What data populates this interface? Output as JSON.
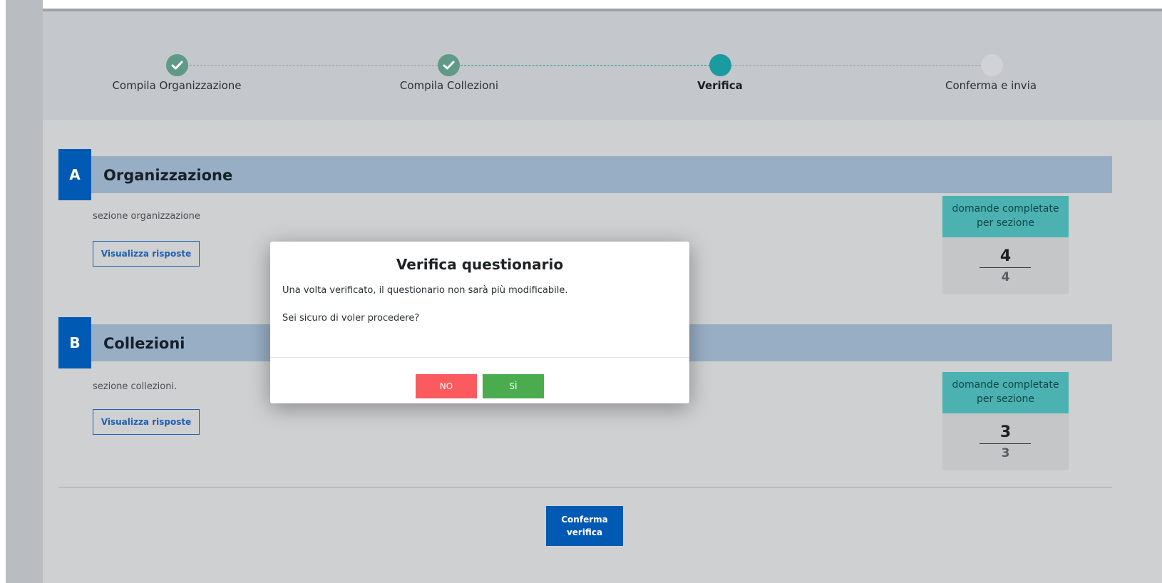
{
  "stepper": {
    "steps": [
      {
        "label": "Compila Organizzazione",
        "state": "done",
        "icon": "check-icon"
      },
      {
        "label": "Compila Collezioni",
        "state": "done",
        "icon": "check-icon"
      },
      {
        "label": "Verifica",
        "state": "current"
      },
      {
        "label": "Conferma e invia",
        "state": "todo"
      }
    ]
  },
  "sections": [
    {
      "letter": "A",
      "title": "Organizzazione",
      "description": "sezione organizzazione",
      "view_button": "Visualizza risposte",
      "stat": {
        "header": "domande completate per sezione",
        "completed": "4",
        "total": "4"
      }
    },
    {
      "letter": "B",
      "title": "Collezioni",
      "description": "sezione collezioni.",
      "view_button": "Visualizza risposte",
      "stat": {
        "header": "domande completate per sezione",
        "completed": "3",
        "total": "3"
      }
    }
  ],
  "footer": {
    "confirm_button": "Conferma verifica"
  },
  "dialog": {
    "title": "Verifica questionario",
    "message": "Una volta verificato, il questionario non sarà più modificabile.",
    "question": "Sei sicuro di voler procedere?",
    "no_label": "NO",
    "yes_label": "SÌ"
  },
  "colors": {
    "accent_blue": "#0059b3",
    "section_bar": "#98aec4",
    "stat_header": "#4bb1b1",
    "step_done": "#5f9a86",
    "step_current": "#1b9aa0",
    "no_button": "#fb5a5e",
    "yes_button": "#4aac4f"
  }
}
